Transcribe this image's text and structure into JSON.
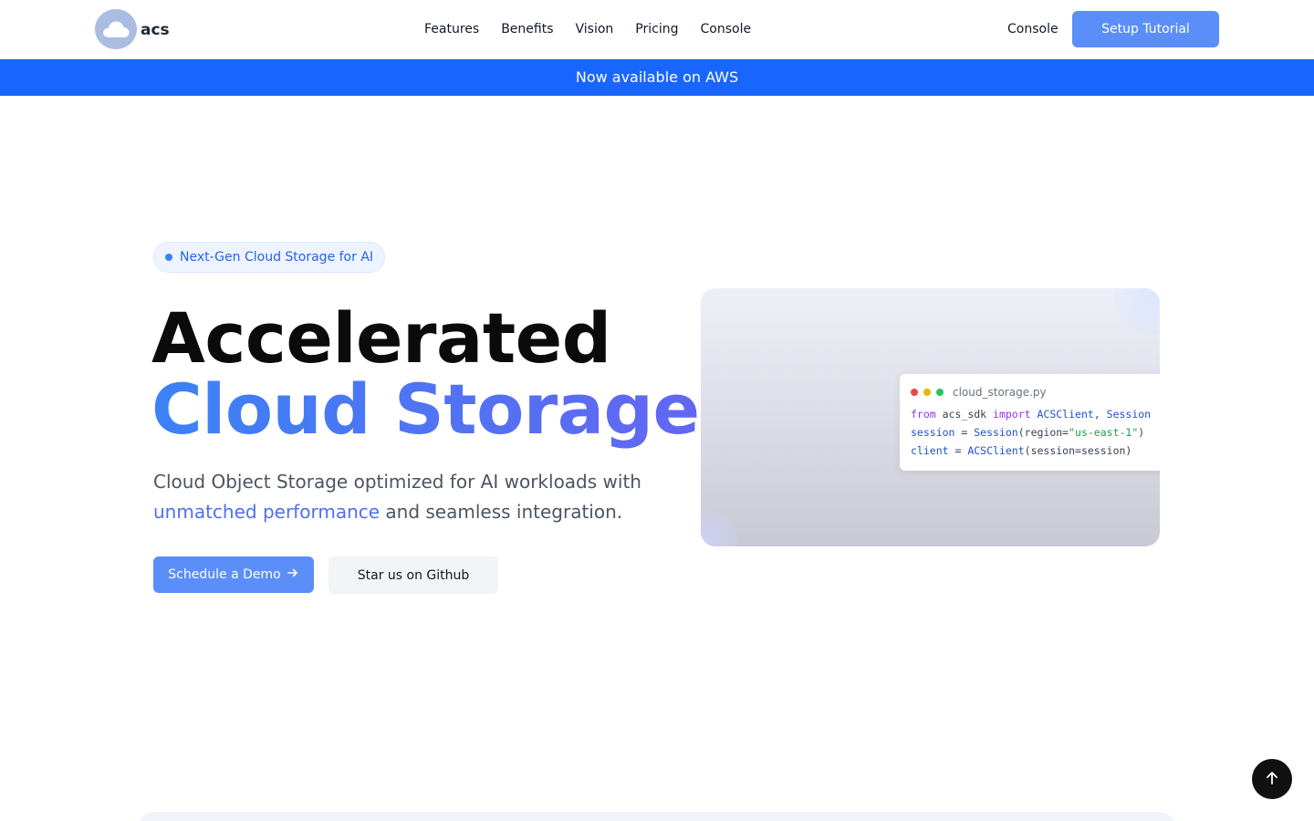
{
  "header": {
    "logo_text": "acs",
    "nav": [
      "Features",
      "Benefits",
      "Vision",
      "Pricing",
      "Console"
    ],
    "console_link": "Console",
    "setup_button": "Setup Tutorial"
  },
  "announcement": "Now available on AWS",
  "hero": {
    "pill": "Next-Gen Cloud Storage for AI",
    "title_line1": "Accelerated",
    "title_line2": "Cloud Storage",
    "subtitle_pre": "Cloud Object Storage optimized for AI workloads with ",
    "subtitle_highlight": "unmatched performance",
    "subtitle_post": " and seamless integration.",
    "demo_button": "Schedule a Demo",
    "github_button": "Star us on Github"
  },
  "code_card": {
    "filename": "cloud_storage.py",
    "line1": {
      "from": "from",
      "module": " acs_sdk ",
      "import": "import",
      "names": " ACSClient, Session"
    },
    "line2": {
      "var": "session",
      "eq": " = ",
      "cls": "Session",
      "args_pre": "(region=",
      "str": "\"us-east-1\"",
      "args_post": ")"
    },
    "line3": {
      "var": "client",
      "eq": " = ",
      "cls": "ACSClient",
      "args": "(session=session)"
    }
  },
  "colors": {
    "accent": "#5b8ef8",
    "banner": "#1866ff",
    "gradient_start": "#3b82f6",
    "gradient_end": "#6366f1"
  },
  "icons": {
    "logo": "cloud-icon",
    "demo_arrow": "arrow-right-icon",
    "scroll_top": "arrow-up-icon"
  }
}
